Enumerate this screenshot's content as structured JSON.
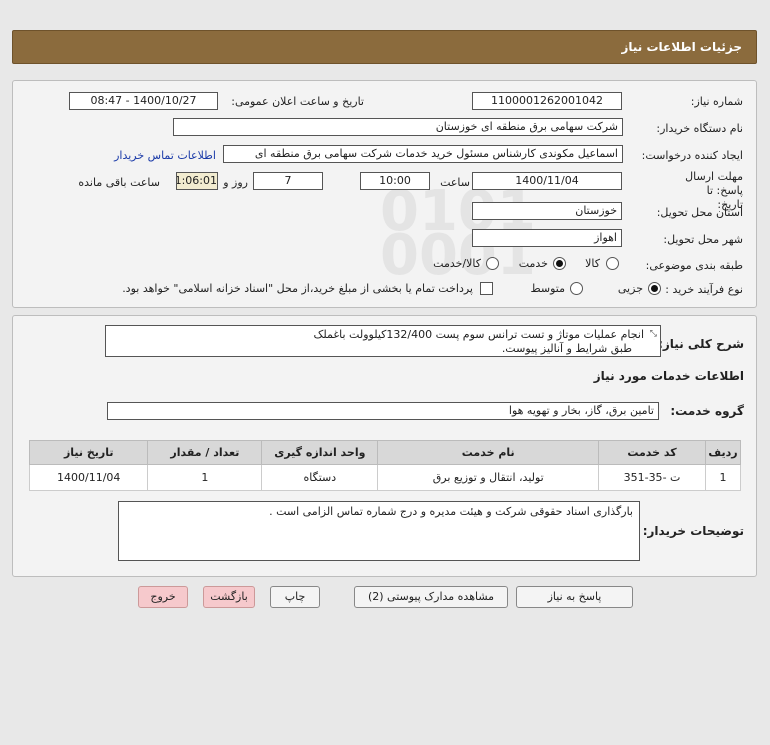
{
  "header": {
    "title": "جزئیات اطلاعات نیاز"
  },
  "fields": {
    "need_number_label": "شماره نیاز:",
    "need_number": "1100001262001042",
    "announce_label": "تاریخ و ساعت اعلان عمومی:",
    "announce_value": "1400/10/27 - 08:47",
    "buyer_org_label": "نام دستگاه خریدار:",
    "buyer_org": "شرکت سهامی برق منطقه ای خوزستان",
    "requester_label": "ایجاد کننده درخواست:",
    "requester": "اسماعیل مکوندی کارشناس مسئول خرید خدمات شرکت سهامی برق منطقه ای",
    "contact_link": "اطلاعات تماس خریدار",
    "deadline_label": "مهلت ارسال پاسخ: تا تاریخ:",
    "deadline_date": "1400/11/04",
    "time_label": "ساعت",
    "deadline_time": "10:00",
    "days_value": "7",
    "days_label": "روز و",
    "remaining_time": "01:06:01",
    "remaining_label": "ساعت باقی مانده",
    "province_label": "استان محل تحویل:",
    "province": "خوزستان",
    "city_label": "شهر محل تحویل:",
    "city": "اهواز",
    "category_label": "طبقه بندی موضوعی:",
    "category_options": [
      "کالا",
      "خدمت",
      "کالا/خدمت"
    ],
    "process_label": "نوع فرآیند خرید :",
    "process_options": [
      "جزیی",
      "متوسط"
    ],
    "payment_note": "پرداخت تمام یا بخشی از مبلغ خرید،از محل \"اسناد خزانه اسلامی\" خواهد بود."
  },
  "summary": {
    "label": "شرح کلی نیاز:",
    "line1": "انجام عملیات موتاژ و تست ترانس سوم پست 132/400کیلوولت باغملک",
    "line2": "طبق شرایط و آنالیز پیوست."
  },
  "services": {
    "section_title": "اطلاعات خدمات مورد نیاز",
    "group_label": "گروه خدمت:",
    "group_value": "تامین برق، گاز، بخار و تهویه هوا",
    "columns": [
      "ردیف",
      "کد خدمت",
      "نام خدمت",
      "واحد اندازه گیری",
      "تعداد / مقدار",
      "تاریخ نیاز"
    ],
    "rows": [
      [
        "1",
        "ت -35-351",
        "تولید، انتقال و توزیع برق",
        "دستگاه",
        "1",
        "1400/11/04"
      ]
    ]
  },
  "buyer_notes": {
    "label": "توضیحات خریدار:",
    "text": "بارگذاری اسناد حقوقی شرکت و هیئت مدیره و درج شماره تماس الزامی است ."
  },
  "buttons": {
    "reply": "پاسخ به نیاز",
    "view_docs": "مشاهده مدارک پیوستی (2)",
    "print": "چاپ",
    "back": "بازگشت",
    "exit": "خروج"
  },
  "watermark": {
    "line1": "ParsNamadData",
    "phone": "۰۲۱-۸۸۳۴۹۶۷۰-۵"
  }
}
